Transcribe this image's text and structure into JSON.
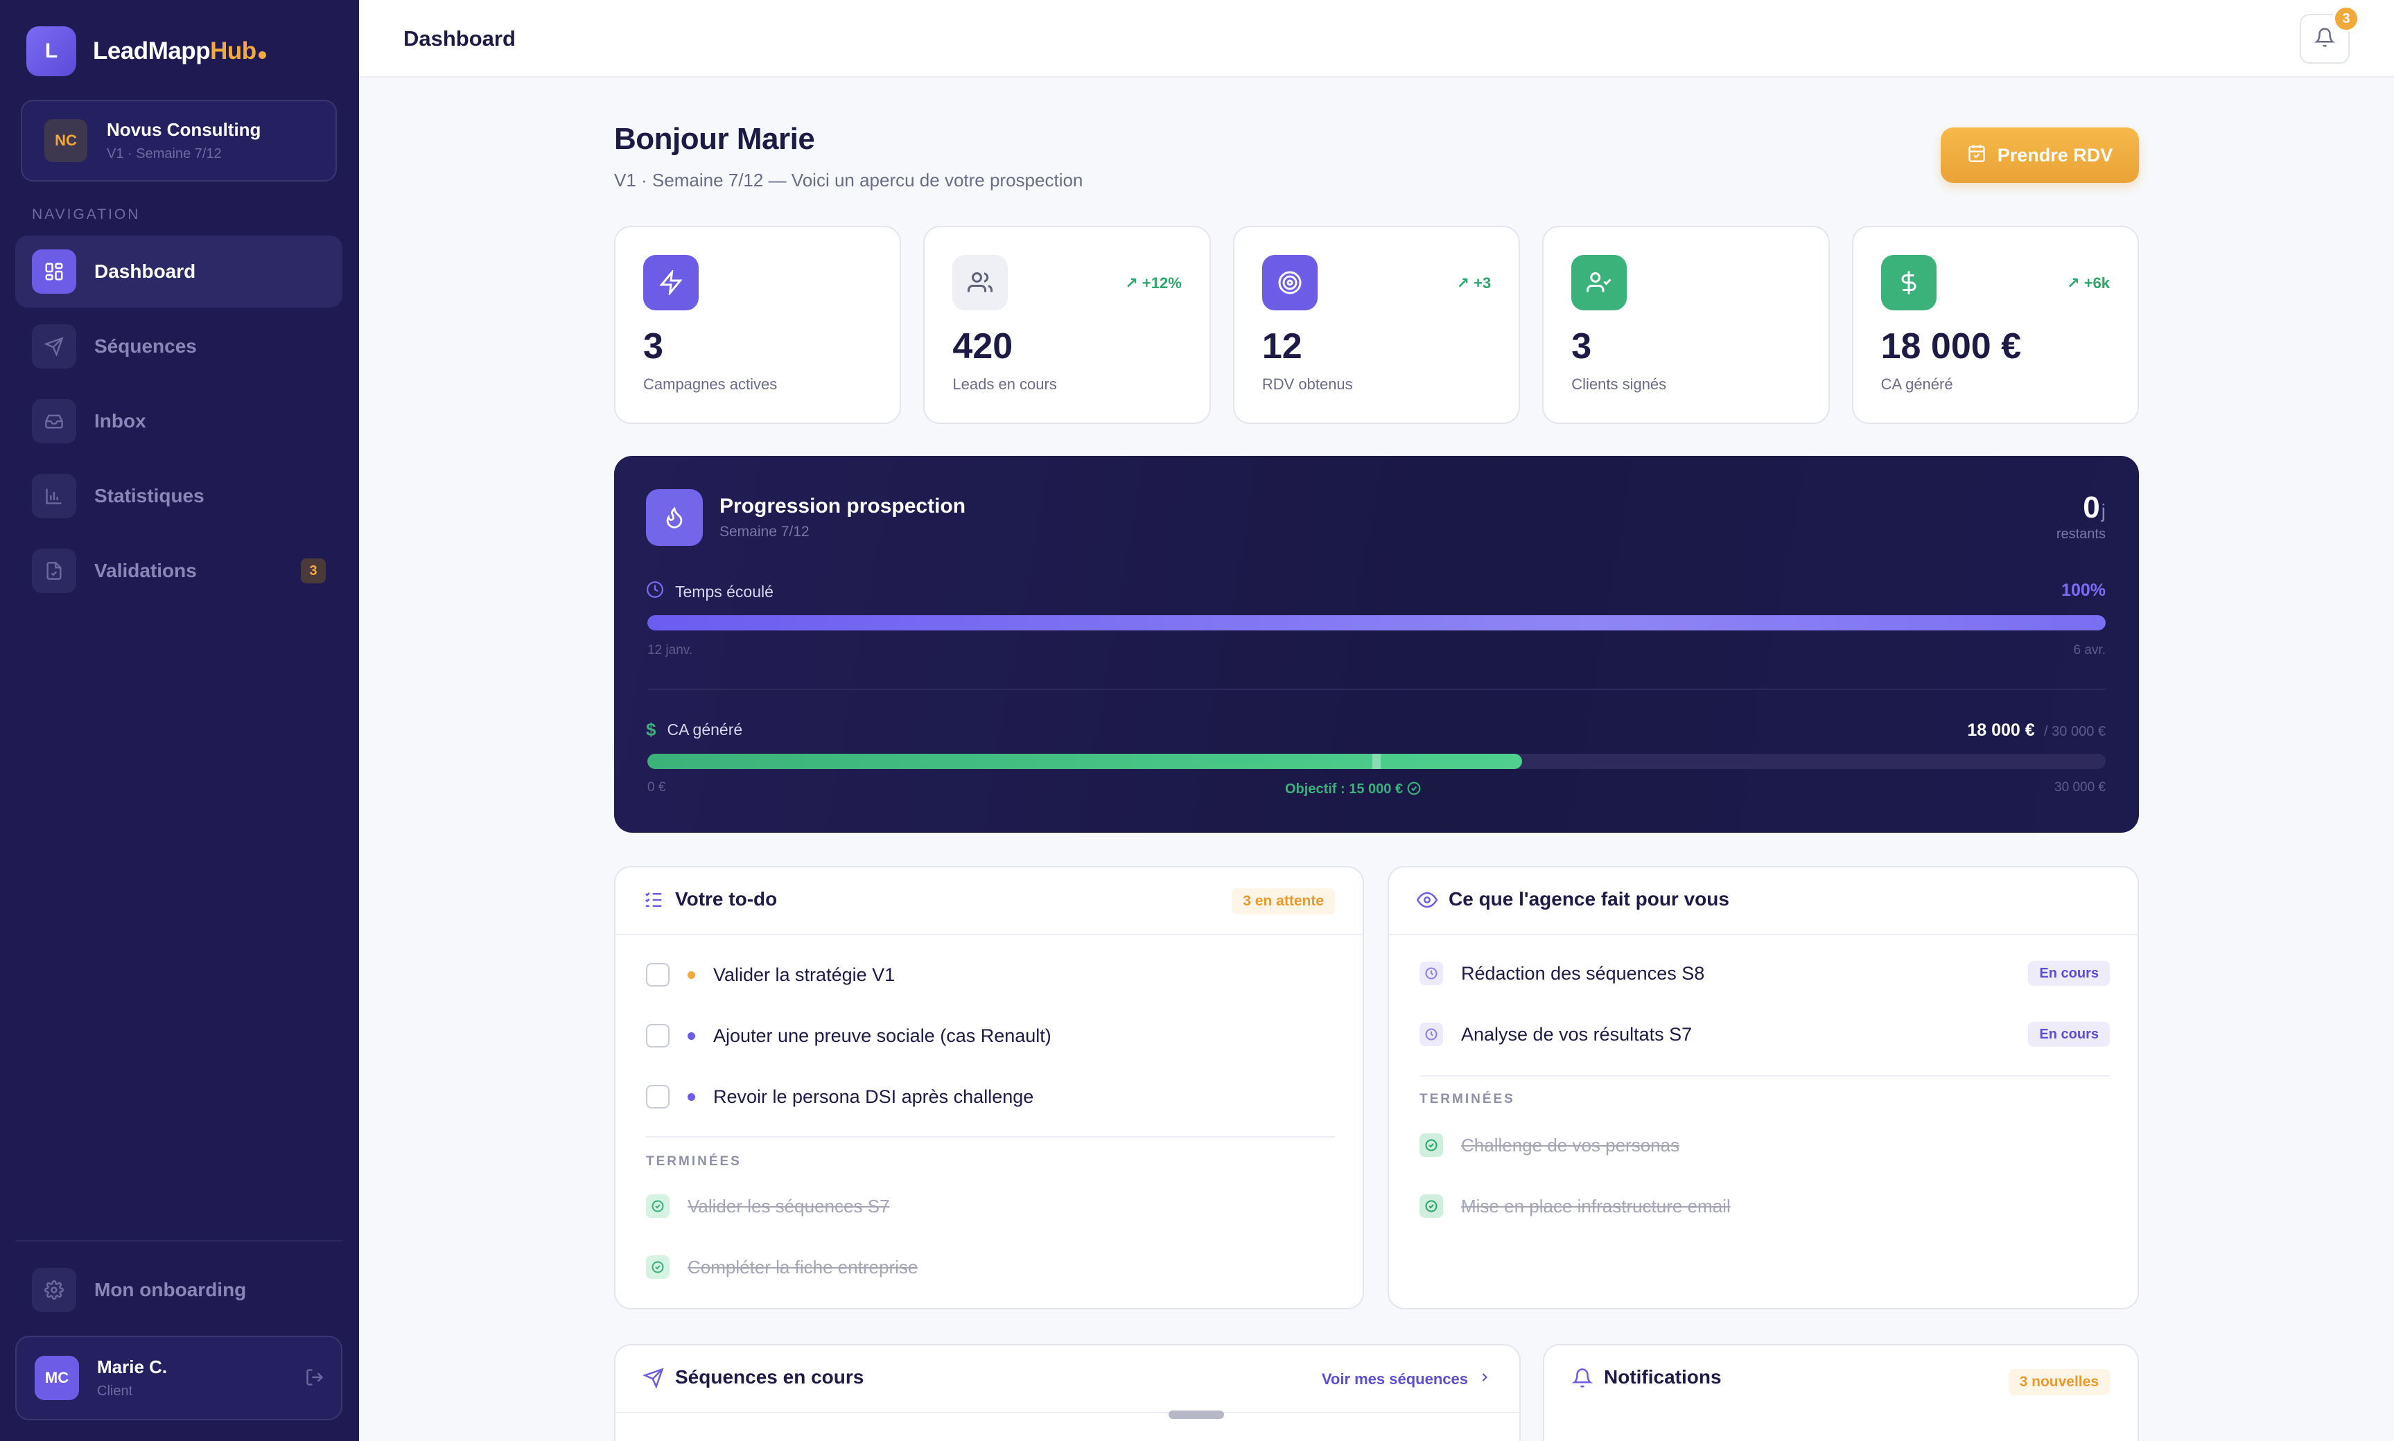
{
  "app": {
    "logo_letter": "L",
    "name_main": "LeadMapp",
    "name_accent": "Hub"
  },
  "org": {
    "initials": "NC",
    "name": "Novus Consulting",
    "sub": "V1 · Semaine 7/12"
  },
  "nav": {
    "title": "NAVIGATION",
    "items": [
      {
        "label": "Dashboard",
        "icon": "grid-icon",
        "active": true
      },
      {
        "label": "Séquences",
        "icon": "send-icon"
      },
      {
        "label": "Inbox",
        "icon": "inbox-icon"
      },
      {
        "label": "Statistiques",
        "icon": "bar-chart-icon"
      },
      {
        "label": "Validations",
        "icon": "file-check-icon",
        "badge": "3"
      }
    ],
    "onboarding": "Mon onboarding"
  },
  "user": {
    "initials": "MC",
    "name": "Marie C.",
    "role": "Client"
  },
  "topbar": {
    "title": "Dashboard",
    "notif_count": "3"
  },
  "greeting": {
    "title": "Bonjour Marie",
    "subtitle": "V1 · Semaine 7/12 — Voici un apercu de votre prospection",
    "cta": "Prendre RDV"
  },
  "stats": [
    {
      "value": "3",
      "label": "Campagnes actives",
      "trend": "",
      "icon": "zap-icon",
      "color": "#6d5de6"
    },
    {
      "value": "420",
      "label": "Leads en cours",
      "trend": "+12%",
      "icon": "users-icon",
      "color": "#eef0f5"
    },
    {
      "value": "12",
      "label": "RDV obtenus",
      "trend": "+3",
      "icon": "target-icon",
      "color": "#6d5de6"
    },
    {
      "value": "3",
      "label": "Clients signés",
      "trend": "",
      "icon": "user-check-icon",
      "color": "#3bb27a"
    },
    {
      "value": "18 000 €",
      "label": "CA généré",
      "trend": "+6k",
      "icon": "dollar-icon",
      "color": "#3bb27a"
    }
  ],
  "progress": {
    "title": "Progression prospection",
    "subtitle": "Semaine 7/12",
    "days_left": "0",
    "days_unit": "j",
    "days_label": "restants",
    "time_label": "Temps écoulé",
    "time_percent": "100%",
    "time_fraction": 1.0,
    "time_start": "12 janv.",
    "time_end": "6 avr.",
    "ca_label": "CA généré",
    "ca_value": "18 000 €",
    "ca_target": "/ 30 000 €",
    "ca_fraction": 0.6,
    "objective_fraction": 0.5,
    "ca_start": "0 €",
    "ca_end": "30 000 €",
    "objective": "Objectif : 15 000 €"
  },
  "todo": {
    "title": "Votre to-do",
    "pending": "3 en attente",
    "items": [
      {
        "text": "Valider la stratégie V1",
        "dot": "#f0a93a"
      },
      {
        "text": "Ajouter une preuve sociale (cas Renault)",
        "dot": "#6d5de6"
      },
      {
        "text": "Revoir le persona DSI après challenge",
        "dot": "#6d5de6"
      }
    ],
    "done_label": "TERMINÉES",
    "done": [
      "Valider les séquences S7",
      "Compléter la fiche entreprise"
    ]
  },
  "agency": {
    "title": "Ce que l'agence fait pour vous",
    "items": [
      {
        "text": "Rédaction des séquences S8",
        "status": "En cours"
      },
      {
        "text": "Analyse de vos résultats S7",
        "status": "En cours"
      }
    ],
    "done_label": "TERMINÉES",
    "done": [
      "Challenge de vos personas",
      "Mise en place infrastructure email"
    ]
  },
  "sequences": {
    "title": "Séquences en cours",
    "link": "Voir mes séquences"
  },
  "notifications": {
    "title": "Notifications",
    "badge": "3 nouvelles"
  }
}
